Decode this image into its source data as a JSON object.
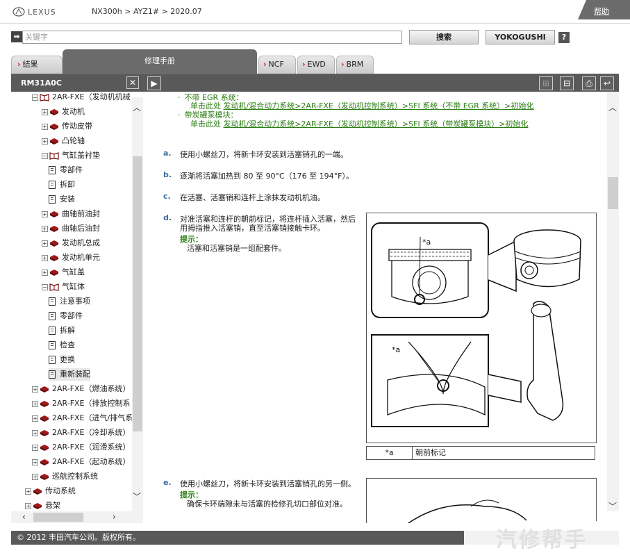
{
  "header": {
    "brand": "LEXUS",
    "breadcrumb": "NX300h > AYZ1# > 2020.07",
    "help": "帮助"
  },
  "search": {
    "placeholder": "关键字",
    "search_button": "搜索",
    "yokogushi_button": "YOKOGUSHI",
    "help_button": "?"
  },
  "tabs": {
    "results": "结果",
    "manual": "修理手册",
    "ncf": "NCF",
    "ewd": "EWD",
    "brm": "BRM"
  },
  "left_panel": {
    "title": "RM31A0C",
    "close": "✕",
    "tree": [
      {
        "label": "2AR-FXE（发动机机械",
        "icon": "open-book-icon",
        "exp": "⊟",
        "level": 1
      },
      {
        "label": "发动机",
        "icon": "closed-book-icon",
        "exp": "⊞",
        "level": 2
      },
      {
        "label": "传动皮带",
        "icon": "closed-book-icon",
        "exp": "⊞",
        "level": 2
      },
      {
        "label": "凸轮轴",
        "icon": "closed-book-icon",
        "exp": "⊞",
        "level": 2
      },
      {
        "label": "气缸盖衬垫",
        "icon": "open-book-icon",
        "exp": "⊟",
        "level": 2
      },
      {
        "label": "零部件",
        "icon": "page-icon",
        "exp": "",
        "level": 3
      },
      {
        "label": "拆卸",
        "icon": "page-icon",
        "exp": "",
        "level": 3
      },
      {
        "label": "安装",
        "icon": "page-icon",
        "exp": "",
        "level": 3
      },
      {
        "label": "曲轴前油封",
        "icon": "closed-book-icon",
        "exp": "⊞",
        "level": 2
      },
      {
        "label": "曲轴后油封",
        "icon": "closed-book-icon",
        "exp": "⊞",
        "level": 2
      },
      {
        "label": "发动机总成",
        "icon": "closed-book-icon",
        "exp": "⊞",
        "level": 2
      },
      {
        "label": "发动机单元",
        "icon": "closed-book-icon",
        "exp": "⊞",
        "level": 2
      },
      {
        "label": "气缸盖",
        "icon": "closed-book-icon",
        "exp": "⊞",
        "level": 2
      },
      {
        "label": "气缸体",
        "icon": "open-book-icon",
        "exp": "⊟",
        "level": 2
      },
      {
        "label": "注意事项",
        "icon": "page-icon",
        "exp": "",
        "level": 3
      },
      {
        "label": "零部件",
        "icon": "page-icon",
        "exp": "",
        "level": 3
      },
      {
        "label": "拆解",
        "icon": "page-icon",
        "exp": "",
        "level": 3
      },
      {
        "label": "检查",
        "icon": "page-icon",
        "exp": "",
        "level": 3
      },
      {
        "label": "更换",
        "icon": "page-icon",
        "exp": "",
        "level": 3
      },
      {
        "label": "重新装配",
        "icon": "page-icon",
        "exp": "",
        "level": 3,
        "selected": true
      },
      {
        "label": "2AR-FXE（燃油系统）",
        "icon": "closed-book-icon",
        "exp": "⊞",
        "level": 1
      },
      {
        "label": "2AR-FXE（排放控制系",
        "icon": "closed-book-icon",
        "exp": "⊞",
        "level": 1
      },
      {
        "label": "2AR-FXE（进气/排气系",
        "icon": "closed-book-icon",
        "exp": "⊞",
        "level": 1
      },
      {
        "label": "2AR-FXE（冷却系统）",
        "icon": "closed-book-icon",
        "exp": "⊞",
        "level": 1
      },
      {
        "label": "2AR-FXE（润滑系统）",
        "icon": "closed-book-icon",
        "exp": "⊞",
        "level": 1
      },
      {
        "label": "2AR-FXE（起动系统）",
        "icon": "closed-book-icon",
        "exp": "⊞",
        "level": 1
      },
      {
        "label": "巡航控制系统",
        "icon": "closed-book-icon",
        "exp": "⊞",
        "level": 1
      },
      {
        "label": "传动系统",
        "icon": "closed-book-icon",
        "exp": "⊞",
        "level": 0
      },
      {
        "label": "悬架",
        "icon": "closed-book-icon",
        "exp": "⊞",
        "level": 0
      }
    ]
  },
  "content": {
    "bullet1_text": "不带 EGR 系统：",
    "bullet1_pre": "单击此处",
    "bullet1_link": "发动机/混合动力系统>2AR-FXE（发动机控制系统）>SFI 系统（不带 EGR 系统）>初始化",
    "bullet2_text": "带炭罐泵模块：",
    "bullet2_pre": "单击此处",
    "bullet2_link": "发动机/混合动力系统>2AR-FXE（发动机控制系统）>SFI 系统（带炭罐泵模块）>初始化",
    "steps": [
      {
        "letter": "a.",
        "text": "使用小螺丝刀，将新卡环安装到活塞销孔的一端。"
      },
      {
        "letter": "b.",
        "text": "逐渐将活塞加热到 80 至 90°C（176 至 194°F）。"
      },
      {
        "letter": "c.",
        "text": "在活塞、活塞销和连杆上涂抹发动机机油。"
      },
      {
        "letter": "d.",
        "text_line1": "对准活塞和连杆的朝前标记，将连杆插入活塞，然后",
        "text_line2": "用拇指推入活塞销，直至活塞销接触卡环。",
        "hint_label": "提示：",
        "hint": "活塞和活塞销是一组配套件。"
      },
      {
        "letter": "e.",
        "text": "使用小螺丝刀，将新卡环安装到活塞销孔的另一侧。",
        "hint_label": "提示：",
        "hint": "确保卡环端隙未与活塞的检修孔切口部位对准。"
      }
    ],
    "figure_callout": "*a",
    "legend_key": "*a",
    "legend_value": "朝前标记"
  },
  "footer": {
    "copyright": "© 2012 丰田汽车公司。版权所有。",
    "watermark": "汽修帮手"
  }
}
